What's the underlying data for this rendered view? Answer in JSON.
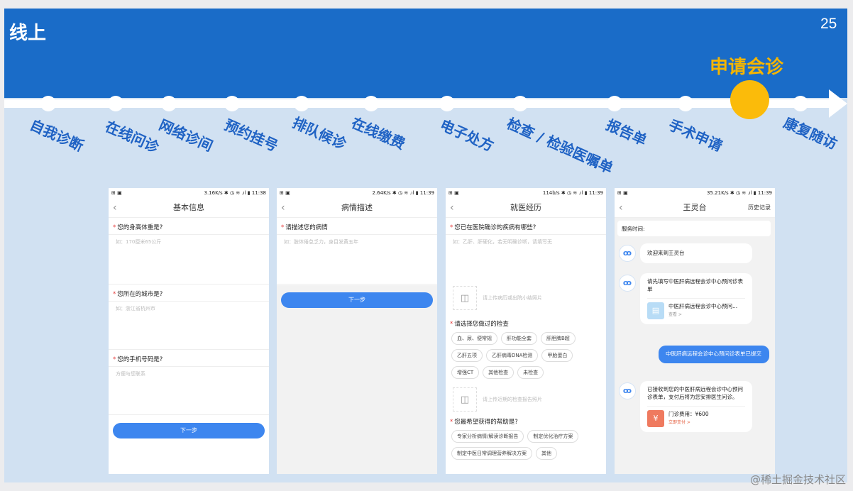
{
  "slide": {
    "title": "线上",
    "page_number": "25",
    "active_step": "申请会诊",
    "steps": [
      "自我诊断",
      "在线问诊",
      "网络诊间",
      "预约挂号",
      "排队候诊",
      "在线缴费",
      "电子处方",
      "检查 / 检验医嘱单",
      "报告单",
      "手术申请",
      "康复随访"
    ]
  },
  "phone1": {
    "status_left": "⊞ ▣",
    "status_right": "3.16K/s ✱ ◷ ≋ .ıl ▮ 11:38",
    "title": "基本信息",
    "q1": "您的身高体重是?",
    "q1_placeholder": "如：170厘米65公斤",
    "q2": "您所在的城市是?",
    "q2_placeholder": "如：浙江省杭州市",
    "q3": "您的手机号码是?",
    "q3_placeholder": "方便与您联系",
    "next": "下一步"
  },
  "phone2": {
    "status_left": "⊞ ▣",
    "status_right": "2.64K/s ✱ ◷ ≋ .ıl ▮ 11:39",
    "title": "病情描述",
    "q1": "请描述您的病情",
    "q1_placeholder": "如：肢体倦怠乏力，身目发黄五年",
    "next": "下一步"
  },
  "phone3": {
    "status_left": "⊞ ▣",
    "status_right": "114b/s ✱ ◷ ≋ .ıl ▮ 11:39",
    "title": "就医经历",
    "q1": "您已在医院确诊的疾病有哪些?",
    "q1_placeholder": "如：乙肝、肝硬化，若无明确诊断，请填写无",
    "upload1": "请上传病历或出院小结照片",
    "q2": "请选择您做过的检查",
    "checks": [
      "血、尿、便常规",
      "肝功能全套",
      "肝胆脾B超",
      "乙肝五项",
      "乙肝病毒DNA检测",
      "甲胎蛋白",
      "增强CT",
      "其他检查",
      "未检查"
    ],
    "upload2": "请上传近期的检查报告照片",
    "q3": "您最希望获得的帮助是?",
    "helps": [
      "专家分析病情/解读诊断报告",
      "制定优化治疗方案",
      "制定中医日常调理营养解决方案",
      "其他"
    ]
  },
  "phone4": {
    "status_left": "⊞ ▣",
    "status_right": "35.21K/s ✱ ◷ ≋ .ıl ▮ 11:39",
    "title": "王灵台",
    "history": "历史记录",
    "service_time": "服务时间:",
    "msg1": "欢迎来到王灵台",
    "msg2": "请先填写中医肝病远程会诊中心预问诊表单",
    "card1_title": "中医肝病远程会诊中心预问...",
    "card1_sub": "查看 >",
    "user_msg": "中医肝病远程会诊中心预问诊表单已提交",
    "msg3": "已接收到您的中医肝病远程会诊中心预问诊表单，支付后将为您安排医生问诊。",
    "card2_title": "门诊费用：¥600",
    "card2_sub": "立即支付 >"
  },
  "watermark": "@稀土掘金技术社区"
}
